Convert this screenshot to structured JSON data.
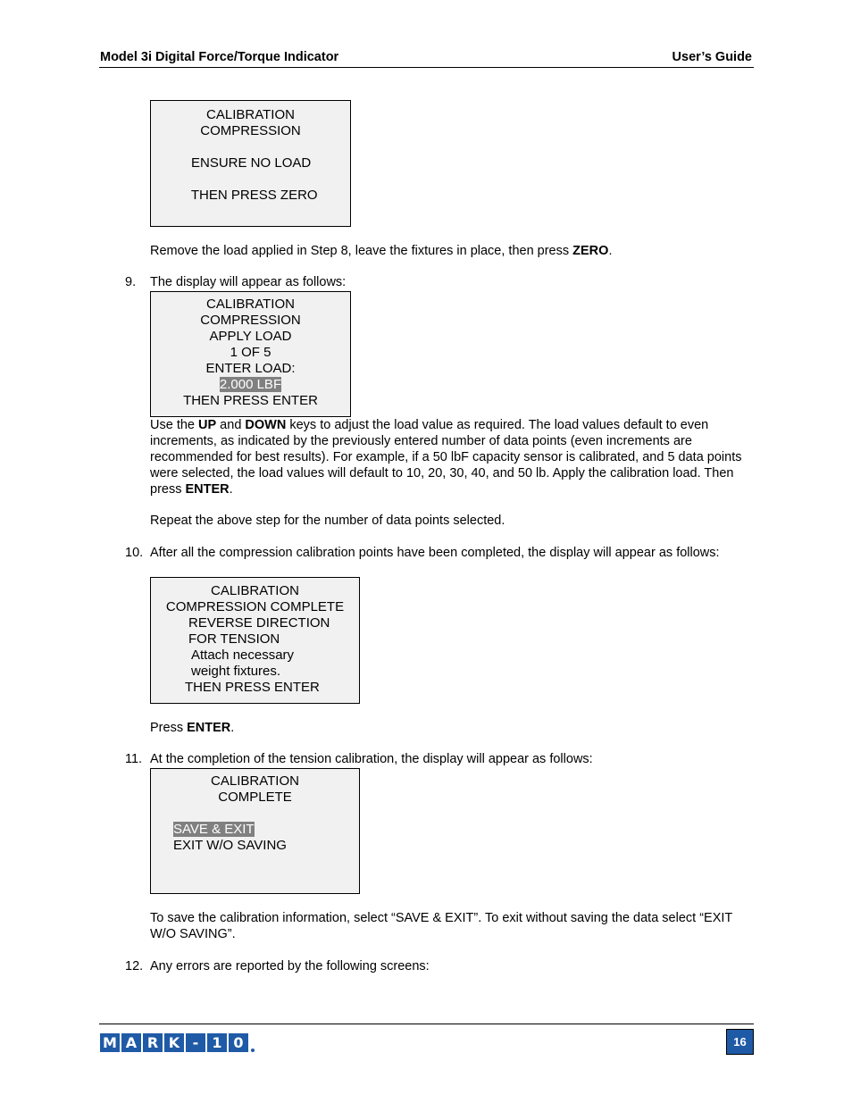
{
  "header": {
    "title": "Model 3i Digital Force/Torque Indicator",
    "guide": "User’s Guide"
  },
  "screen1": {
    "lines": [
      "CALIBRATION",
      "COMPRESSION",
      "",
      "ENSURE NO LOAD",
      "",
      " THEN PRESS ZERO"
    ]
  },
  "text1": {
    "before": "Remove the load applied in Step 8, leave the fixtures in place, then press ",
    "bold": "ZERO",
    "after": "."
  },
  "step9": {
    "number": "9.",
    "text": "The display will appear as follows:"
  },
  "screen2": {
    "lines": [
      "CALIBRATION",
      "COMPRESSION",
      "APPLY LOAD",
      "1 OF 5",
      "ENTER LOAD:"
    ],
    "highlight": "2.000 LBF",
    "last": "THEN PRESS ENTER"
  },
  "text2": {
    "p1": "Use the ",
    "b1": "UP",
    "p2": " and ",
    "b2": "DOWN",
    "p3": " keys to adjust the load value as required. The load values default to even increments, as indicated by the previously entered number of data points (even increments are recommended for best results). For example, if a 50 lbF capacity sensor is calibrated, and 5 data points were selected, the load values will default to 10, 20, 30, 40, and 50 lb. Apply the calibration load. Then press ",
    "b3": "ENTER",
    "p4": "."
  },
  "text3": "Repeat the above step for the number of data points selected.",
  "step10": {
    "number": "10.",
    "text": "After all the compression calibration points have been completed, the display will appear as follows:"
  },
  "screen3": {
    "lines": [
      "CALIBRATION",
      "COMPRESSION COMPLETE",
      "REVERSE DIRECTION",
      "FOR TENSION",
      "Attach necessary",
      "weight fixtures.",
      "THEN PRESS ENTER"
    ]
  },
  "text4": {
    "before": "Press ",
    "bold": "ENTER",
    "after": "."
  },
  "step11": {
    "number": "11.",
    "text": "At the completion of the tension calibration, the display will appear as follows:"
  },
  "screen4": {
    "title1": "CALIBRATION",
    "title2": "COMPLETE",
    "option_selected": "SAVE & EXIT",
    "option2": "EXIT W/O SAVING"
  },
  "text5": "To save the calibration information, select “SAVE & EXIT”. To exit without saving the data select “EXIT W/O SAVING”.",
  "step12": {
    "number": "12.",
    "text": "Any errors are reported by the following screens:"
  },
  "footer": {
    "logo_letters": [
      "M",
      "A",
      "R",
      "K",
      "-",
      "1",
      "0"
    ],
    "page_number": "16",
    "brand_color": "#1f5aa6"
  }
}
